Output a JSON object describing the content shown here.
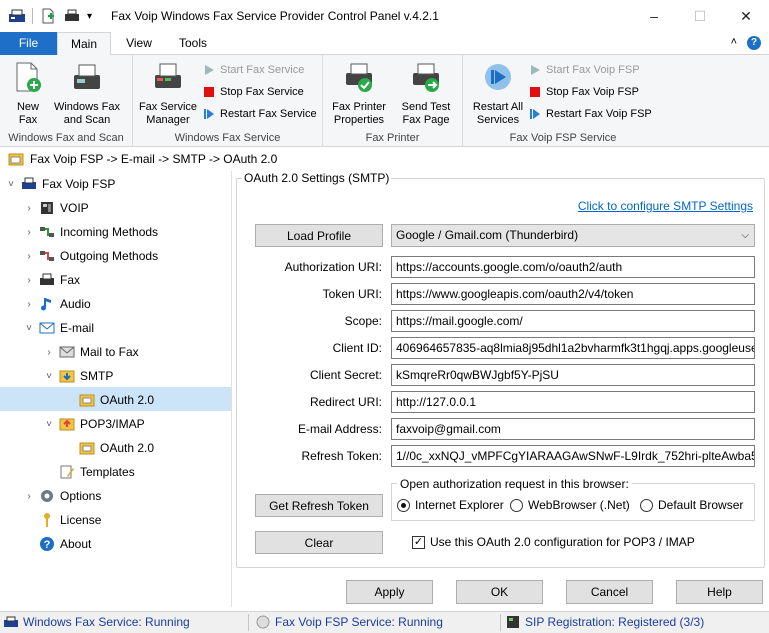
{
  "window": {
    "title": "Fax Voip Windows Fax Service Provider Control Panel v.4.2.1",
    "minimize": "–",
    "maximize": "☐",
    "close": "✕"
  },
  "ribbon_tabs": {
    "file": "File",
    "main": "Main",
    "view": "View",
    "tools": "Tools",
    "collapse": "˄",
    "help": "?"
  },
  "ribbon": {
    "group1": {
      "label": "Windows Fax and Scan",
      "new_fax": "New\nFax",
      "wfs": "Windows Fax\nand Scan"
    },
    "group2": {
      "label": "Windows Fax Service",
      "manager": "Fax Service\nManager",
      "start": "Start Fax Service",
      "stop": "Stop Fax Service",
      "restart": "Restart Fax Service"
    },
    "group3": {
      "label": "Fax Printer",
      "props": "Fax Printer\nProperties",
      "test": "Send Test\nFax Page"
    },
    "group4": {
      "label": "Fax Voip FSP Service",
      "restart_all": "Restart All\nServices",
      "start": "Start Fax Voip FSP",
      "stop": "Stop Fax Voip FSP",
      "restart": "Restart Fax Voip FSP"
    }
  },
  "breadcrumb": "Fax Voip FSP -> E-mail -> SMTP -> OAuth 2.0",
  "tree": [
    {
      "label": "Fax Voip FSP",
      "chev": "˅"
    },
    {
      "label": "VOIP",
      "chev": "›"
    },
    {
      "label": "Incoming Methods",
      "chev": "›"
    },
    {
      "label": "Outgoing Methods",
      "chev": "›"
    },
    {
      "label": "Fax",
      "chev": "›"
    },
    {
      "label": "Audio",
      "chev": "›"
    },
    {
      "label": "E-mail",
      "chev": "˅"
    },
    {
      "label": "Mail to Fax",
      "chev": "›"
    },
    {
      "label": "SMTP",
      "chev": "˅"
    },
    {
      "label": "OAuth 2.0",
      "chev": ""
    },
    {
      "label": "POP3/IMAP",
      "chev": "˅"
    },
    {
      "label": "OAuth 2.0",
      "chev": ""
    },
    {
      "label": "Templates",
      "chev": ""
    },
    {
      "label": "Options",
      "chev": "›"
    },
    {
      "label": "License",
      "chev": ""
    },
    {
      "label": "About",
      "chev": ""
    }
  ],
  "panel": {
    "title": "OAuth 2.0 Settings (SMTP)",
    "smtp_link": "Click to configure SMTP Settings",
    "load_profile": "Load Profile",
    "profile_value": "Google / Gmail.com (Thunderbird)",
    "labels": {
      "auth_uri": "Authorization URI:",
      "token_uri": "Token URI:",
      "scope": "Scope:",
      "client_id": "Client ID:",
      "client_secret": "Client Secret:",
      "redirect_uri": "Redirect URI:",
      "email": "E-mail Address:",
      "refresh_token": "Refresh Token:"
    },
    "values": {
      "auth_uri": "https://accounts.google.com/o/oauth2/auth",
      "token_uri": "https://www.googleapis.com/oauth2/v4/token",
      "scope": "https://mail.google.com/",
      "client_id": "406964657835-aq8lmia8j95dhl1a2bvharmfk3t1hgqj.apps.googleuserc",
      "client_secret": "kSmqreRr0qwBWJgbf5Y-PjSU",
      "redirect_uri": "http://127.0.0.1",
      "email": "faxvoip@gmail.com",
      "refresh_token": "1//0c_xxNQJ_vMPFCgYIARAAGAwSNwF-L9Irdk_752hri-plteAwba52Z"
    },
    "get_refresh_token": "Get Refresh Token",
    "clear": "Clear",
    "browser_group": "Open authorization request in this browser:",
    "browsers": [
      "Internet Explorer",
      "WebBrowser (.Net)",
      "Default Browser"
    ],
    "pop3_check": "Use this OAuth 2.0 configuration for POP3 / IMAP",
    "check_mark": "✓"
  },
  "dialog_buttons": {
    "apply": "Apply",
    "ok": "OK",
    "cancel": "Cancel",
    "help": "Help"
  },
  "status": {
    "fax_service": "Windows Fax Service: Running",
    "fsp_service": "Fax Voip FSP Service: Running",
    "sip": "SIP Registration: Registered (3/3)"
  }
}
